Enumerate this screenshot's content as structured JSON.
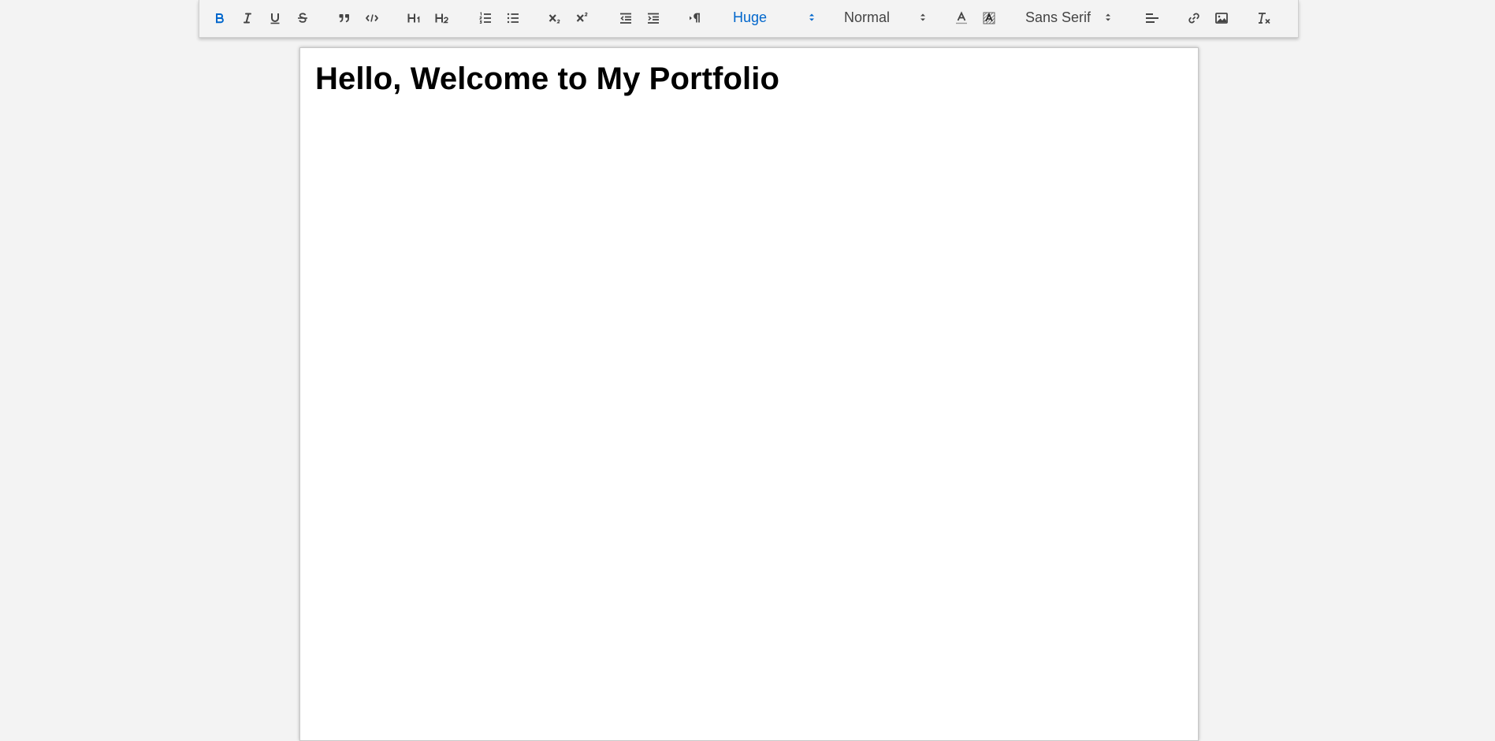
{
  "colors": {
    "active": "#0066cc",
    "icon": "#444444",
    "page_background": "#f3f3f3",
    "document_background": "#ffffff"
  },
  "toolbar": {
    "buttons": [
      {
        "name": "bold",
        "icon": "bold-icon",
        "active": true
      },
      {
        "name": "italic",
        "icon": "italic-icon"
      },
      {
        "name": "underline",
        "icon": "underline-icon"
      },
      {
        "name": "strike",
        "icon": "strikethrough-icon"
      },
      {
        "name": "blockquote",
        "icon": "quote-icon"
      },
      {
        "name": "code-block",
        "icon": "code-icon"
      },
      {
        "name": "header-1",
        "icon": "h1-icon"
      },
      {
        "name": "header-2",
        "icon": "h2-icon"
      },
      {
        "name": "ordered-list",
        "icon": "ordered-list-icon"
      },
      {
        "name": "bullet-list",
        "icon": "bullet-list-icon"
      },
      {
        "name": "subscript",
        "icon": "subscript-icon"
      },
      {
        "name": "superscript",
        "icon": "superscript-icon"
      },
      {
        "name": "outdent",
        "icon": "outdent-icon"
      },
      {
        "name": "indent",
        "icon": "indent-icon"
      },
      {
        "name": "text-direction",
        "icon": "text-direction-icon"
      },
      {
        "name": "font-color",
        "icon": "font-color-icon"
      },
      {
        "name": "background-color",
        "icon": "background-color-icon"
      },
      {
        "name": "align",
        "icon": "align-left-icon"
      },
      {
        "name": "link",
        "icon": "link-icon"
      },
      {
        "name": "image",
        "icon": "image-icon"
      },
      {
        "name": "clean",
        "icon": "clear-formatting-icon"
      }
    ],
    "size_picker": {
      "value": "Huge",
      "active": true
    },
    "header_picker": {
      "value": "Normal"
    },
    "font_picker": {
      "value": "Sans Serif"
    }
  },
  "editor": {
    "heading": "Hello, Welcome to My Portfolio"
  }
}
